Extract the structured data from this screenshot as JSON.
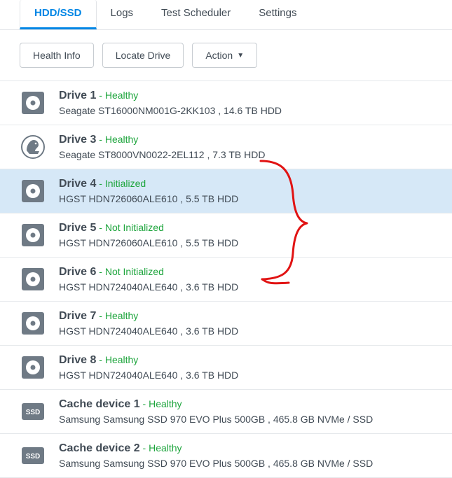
{
  "tabs": [
    {
      "label": "HDD/SSD",
      "active": true
    },
    {
      "label": "Logs",
      "active": false
    },
    {
      "label": "Test Scheduler",
      "active": false
    },
    {
      "label": "Settings",
      "active": false
    }
  ],
  "toolbar": {
    "health_info": "Health Info",
    "locate_drive": "Locate Drive",
    "action": "Action"
  },
  "drives": [
    {
      "name": "Drive 1",
      "status": "Healthy",
      "desc": "Seagate ST16000NM001G-2KK103 , 14.6 TB HDD",
      "icon": "hdd",
      "selected": false
    },
    {
      "name": "Drive 3",
      "status": "Healthy",
      "desc": "Seagate ST8000VN0022-2EL112 , 7.3 TB HDD",
      "icon": "ironwolf",
      "selected": false
    },
    {
      "name": "Drive 4",
      "status": "Initialized",
      "desc": "HGST HDN726060ALE610 , 5.5 TB HDD",
      "icon": "hdd",
      "selected": true
    },
    {
      "name": "Drive 5",
      "status": "Not Initialized",
      "desc": "HGST HDN726060ALE610 , 5.5 TB HDD",
      "icon": "hdd",
      "selected": false
    },
    {
      "name": "Drive 6",
      "status": "Not Initialized",
      "desc": "HGST HDN724040ALE640 , 3.6 TB HDD",
      "icon": "hdd",
      "selected": false
    },
    {
      "name": "Drive 7",
      "status": "Healthy",
      "desc": "HGST HDN724040ALE640 , 3.6 TB HDD",
      "icon": "hdd",
      "selected": false
    },
    {
      "name": "Drive 8",
      "status": "Healthy",
      "desc": "HGST HDN724040ALE640 , 3.6 TB HDD",
      "icon": "hdd",
      "selected": false
    },
    {
      "name": "Cache device 1",
      "status": "Healthy",
      "desc": "Samsung Samsung SSD 970 EVO Plus 500GB , 465.8 GB NVMe / SSD",
      "icon": "ssd",
      "selected": false
    },
    {
      "name": "Cache device 2",
      "status": "Healthy",
      "desc": "Samsung Samsung SSD 970 EVO Plus 500GB , 465.8 GB NVMe / SSD",
      "icon": "ssd",
      "selected": false
    }
  ]
}
